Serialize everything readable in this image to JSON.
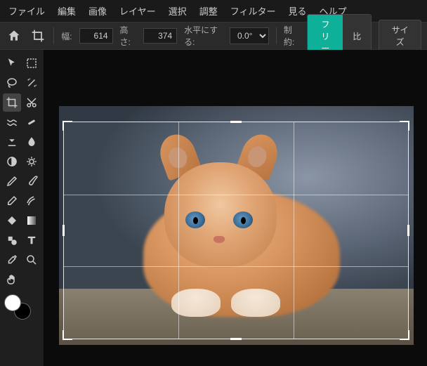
{
  "menubar": {
    "file": "ファイル",
    "edit": "編集",
    "image": "画像",
    "layer": "レイヤー",
    "select": "選択",
    "adjust": "調整",
    "filter": "フィルター",
    "view": "見る",
    "help": "ヘルプ"
  },
  "toolbar": {
    "width_label": "幅:",
    "width_value": "614",
    "height_label": "高さ:",
    "height_value": "374",
    "level_label": "水平にする:",
    "level_value": "0.0°",
    "constraint_label": "制約:",
    "free_label": "フリー",
    "ratio_label": "比",
    "size_label": "サイズ"
  },
  "colors": {
    "accent": "#0fb09a",
    "foreground": "#ffffff",
    "background": "#000000"
  }
}
